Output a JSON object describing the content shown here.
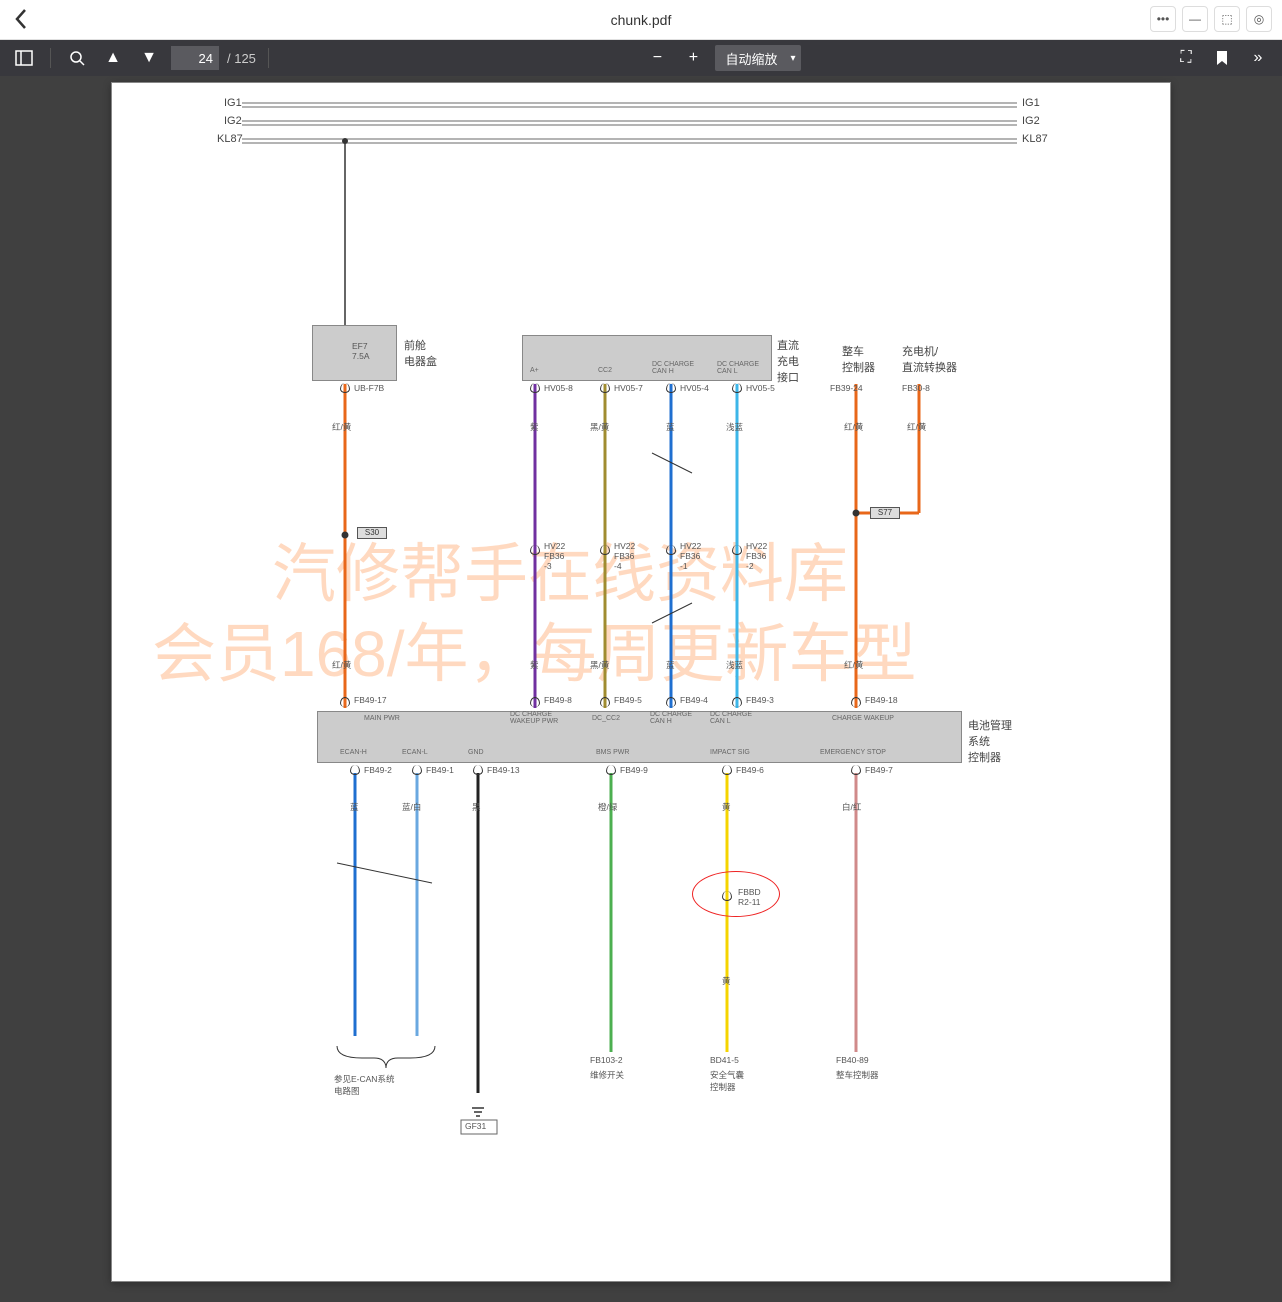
{
  "window": {
    "title": "chunk.pdf"
  },
  "toolbar": {
    "page_current": "24",
    "page_total": "/ 125",
    "zoom_label": "自动缩放"
  },
  "watermark": {
    "line1": "汽修帮手在线资料库",
    "line2": "会员168/年，每周更新车型"
  },
  "bus_labels": {
    "ig1": "IG1",
    "ig2": "IG2",
    "kl87": "KL87"
  },
  "blocks": {
    "fusebox": {
      "fuse": "EF7\n7.5A",
      "name": "前舱\n电器盒"
    },
    "dc_port": {
      "a_plus": "A+",
      "cc2": "CC2",
      "can_h": "DC CHARGE\nCAN H",
      "can_l": "DC CHARGE\nCAN L",
      "name": "直流\n充电\n接口"
    },
    "vcu_top": "整车\n控制器",
    "charger": "充电机/\n直流转换器",
    "bms": {
      "name": "电池管理\n系统\n控制器",
      "top": {
        "main_pwr": "MAIN PWR",
        "dc_wakeup": "DC CHARGE\nWAKEUP PWR",
        "dc_cc2": "DC_CC2",
        "can_h": "DC CHARGE\nCAN H",
        "can_l": "DC CHARGE\nCAN L",
        "chg_wakeup": "CHARGE WAKEUP"
      },
      "bot": {
        "ecan_h": "ECAN-H",
        "ecan_l": "ECAN-L",
        "gnd": "GND",
        "bms_pwr": "BMS PWR",
        "impact": "IMPACT SIG",
        "estop": "EMERGENCY STOP"
      }
    }
  },
  "connectors": {
    "ub_f7b": "UB-F7B",
    "hv05_8": "HV05-8",
    "hv05_7": "HV05-7",
    "hv05_4": "HV05-4",
    "hv05_5": "HV05-5",
    "fb39_24": "FB39-24",
    "fb30_8": "FB30-8",
    "hv22_3": "HV22\nFB36\n-3",
    "hv22_4": "HV22\nFB36\n-4",
    "hv22_1": "HV22\nFB36\n-1",
    "hv22_2": "HV22\nFB36\n-2",
    "fb49_17": "FB49-17",
    "fb49_8": "FB49-8",
    "fb49_5": "FB49-5",
    "fb49_4": "FB49-4",
    "fb49_3": "FB49-3",
    "fb49_18": "FB49-18",
    "fb49_2": "FB49-2",
    "fb49_1": "FB49-1",
    "fb49_13": "FB49-13",
    "fb49_9": "FB49-9",
    "fb49_6": "FB49-6",
    "fb49_7": "FB49-7",
    "fbbd_r2_11": "FBBD\nR2-11",
    "fb103_2": "FB103-2",
    "bd41_5": "BD41-5",
    "fb40_89": "FB40-89"
  },
  "wires": {
    "red_yel": "红/黄",
    "purple": "紫",
    "blk_yel": "黑/黄",
    "blue": "蓝",
    "lt_blue": "浅蓝",
    "blue_wht": "蓝/白",
    "black": "黑",
    "org_grn": "橙/绿",
    "yellow": "黄",
    "wht_red": "白/红"
  },
  "splices": {
    "s30": "S30",
    "s77": "S77"
  },
  "ground": "GF31",
  "refs": {
    "ecan": "参见E-CAN系统\n电路图",
    "repair_sw": "维修开关",
    "airbag": "安全气囊\n控制器",
    "vcu": "整车控制器"
  }
}
